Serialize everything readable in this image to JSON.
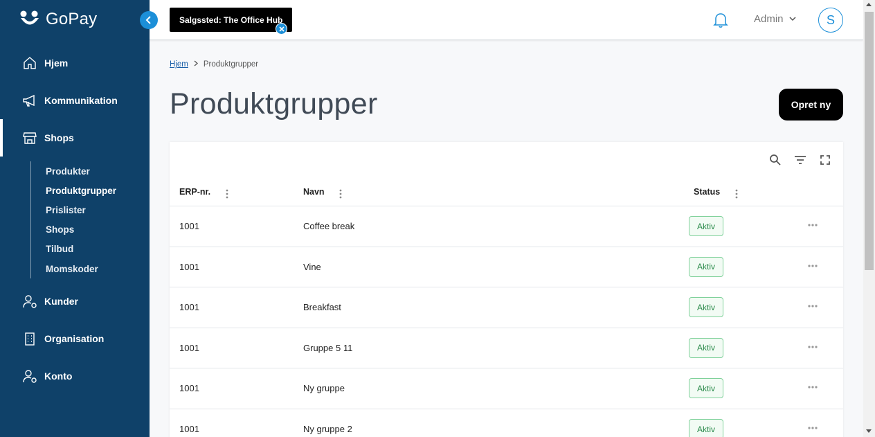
{
  "brand": {
    "name": "GoPay"
  },
  "sidebar": {
    "items": [
      {
        "label": "Hjem",
        "icon": "home-icon"
      },
      {
        "label": "Kommunikation",
        "icon": "megaphone-icon"
      },
      {
        "label": "Shops",
        "icon": "store-icon"
      },
      {
        "label": "Kunder",
        "icon": "user-gear-icon"
      },
      {
        "label": "Organisation",
        "icon": "building-icon"
      },
      {
        "label": "Konto",
        "icon": "user-gear-icon"
      }
    ],
    "sub_items": [
      "Produkter",
      "Produktgrupper",
      "Prislister",
      "Shops",
      "Tilbud",
      "Momskoder"
    ],
    "active_item": "Shops",
    "active_sub_item": "Produktgrupper"
  },
  "topbar": {
    "store_chip": "Salgssted: The Office Hub",
    "user_menu": "Admin",
    "avatar_initial": "S"
  },
  "breadcrumb": {
    "home": "Hjem",
    "current": "Produktgrupper"
  },
  "page": {
    "title": "Produktgrupper",
    "create_label": "Opret ny"
  },
  "table": {
    "columns": [
      "ERP-nr.",
      "Navn",
      "Status"
    ],
    "rows": [
      {
        "erp": "1001",
        "name": "Coffee break",
        "status": "Aktiv"
      },
      {
        "erp": "1001",
        "name": "Vine",
        "status": "Aktiv"
      },
      {
        "erp": "1001",
        "name": "Breakfast",
        "status": "Aktiv"
      },
      {
        "erp": "1001",
        "name": "Gruppe 5 11",
        "status": "Aktiv"
      },
      {
        "erp": "1001",
        "name": "Ny gruppe",
        "status": "Aktiv"
      },
      {
        "erp": "1001",
        "name": "Ny gruppe 2",
        "status": "Aktiv"
      }
    ]
  },
  "colors": {
    "sidebar_bg": "#0f4169",
    "accent": "#1c8fd8",
    "status_active": "#2a8a4a"
  }
}
